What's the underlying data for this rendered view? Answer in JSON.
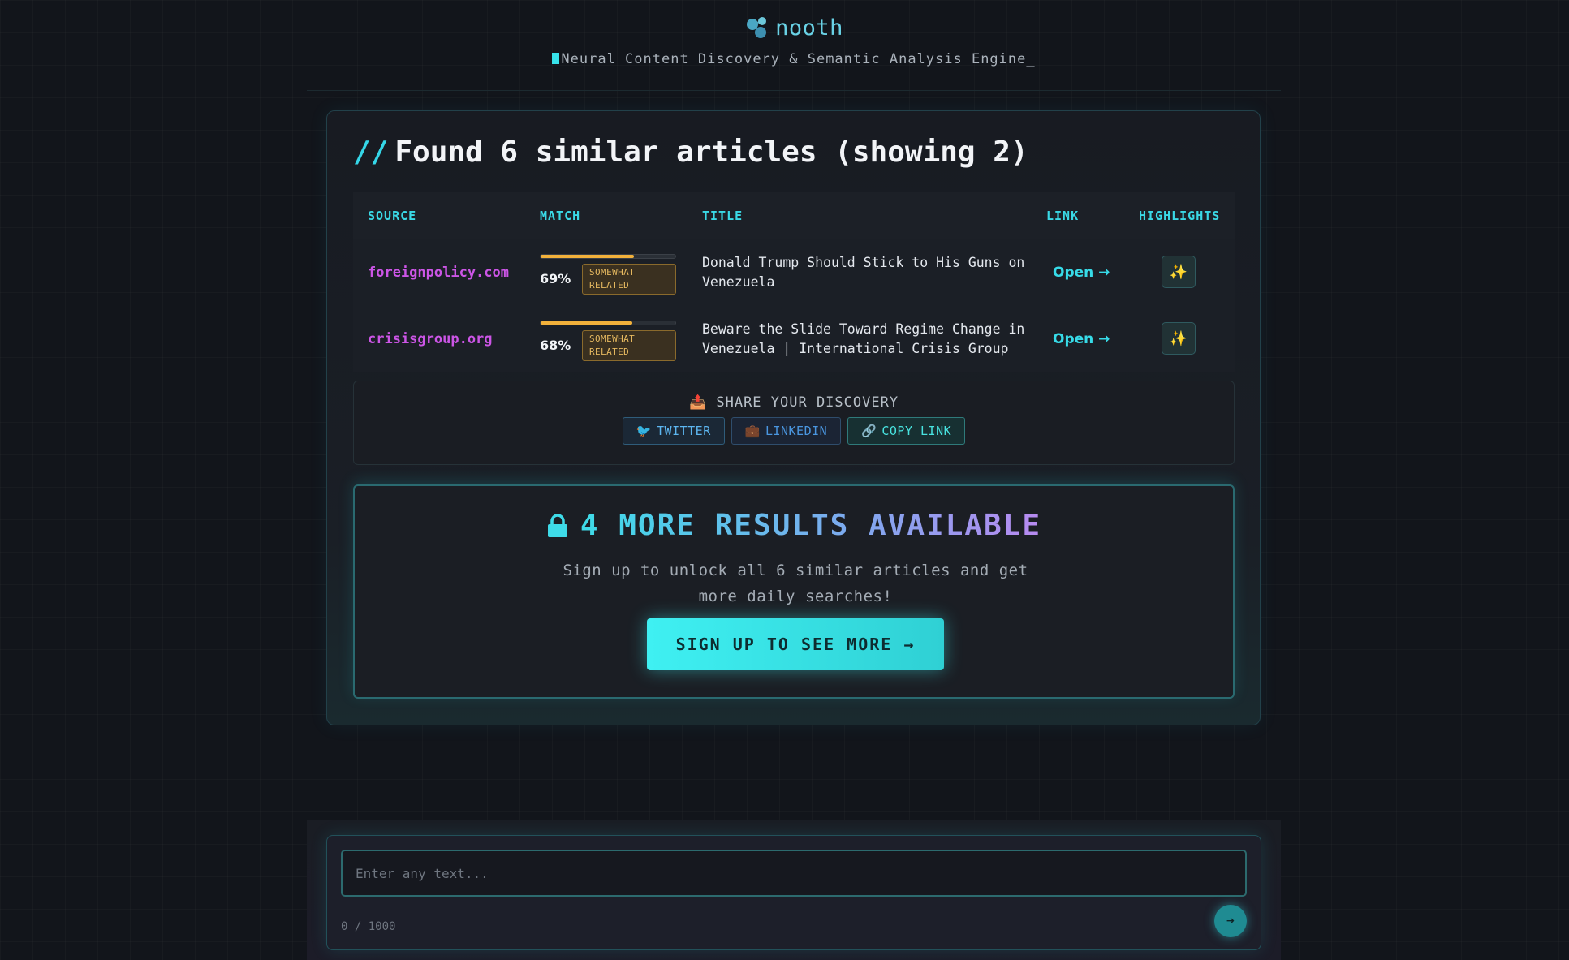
{
  "header": {
    "app_name": "nooth",
    "tagline": "Neural Content Discovery & Semantic Analysis Engine_"
  },
  "results": {
    "heading_prefix": "//",
    "heading": "Found 6 similar articles (showing 2)",
    "columns": {
      "source": "SOURCE",
      "match": "MATCH",
      "title": "TITLE",
      "link": "LINK",
      "highlights": "HIGHLIGHTS"
    },
    "rows": [
      {
        "source": "foreignpolicy.com",
        "match_pct": "69%",
        "match_value": 0.69,
        "match_label_1": "SOMEWHAT",
        "match_label_2": "RELATED",
        "title": "Donald Trump Should Stick to His Guns on Venezuela",
        "link": "Open →",
        "highlight_icon": "sparkles-icon"
      },
      {
        "source": "crisisgroup.org",
        "match_pct": "68%",
        "match_value": 0.68,
        "match_label_1": "SOMEWHAT",
        "match_label_2": "RELATED",
        "title": "Beware the Slide Toward Regime Change in Venezuela | International Crisis Group",
        "link": "Open →",
        "highlight_icon": "sparkles-icon"
      }
    ]
  },
  "share": {
    "title": "SHARE YOUR DISCOVERY",
    "twitter": "TWITTER",
    "linkedin": "LINKEDIN",
    "copy_link": "COPY LINK"
  },
  "unlock": {
    "title": "4 MORE RESULTS AVAILABLE",
    "description": "Sign up to unlock all 6 similar articles and get more daily searches!",
    "button": "SIGN UP TO SEE MORE →"
  },
  "input": {
    "placeholder": "Enter any text...",
    "counter": "0 / 1000",
    "send_icon": "arrow-right-icon"
  },
  "colors": {
    "accent_cyan": "#37dbe8",
    "source_magenta": "#cc55e6",
    "match_amber": "#f2b13b",
    "background": "#12151b"
  }
}
